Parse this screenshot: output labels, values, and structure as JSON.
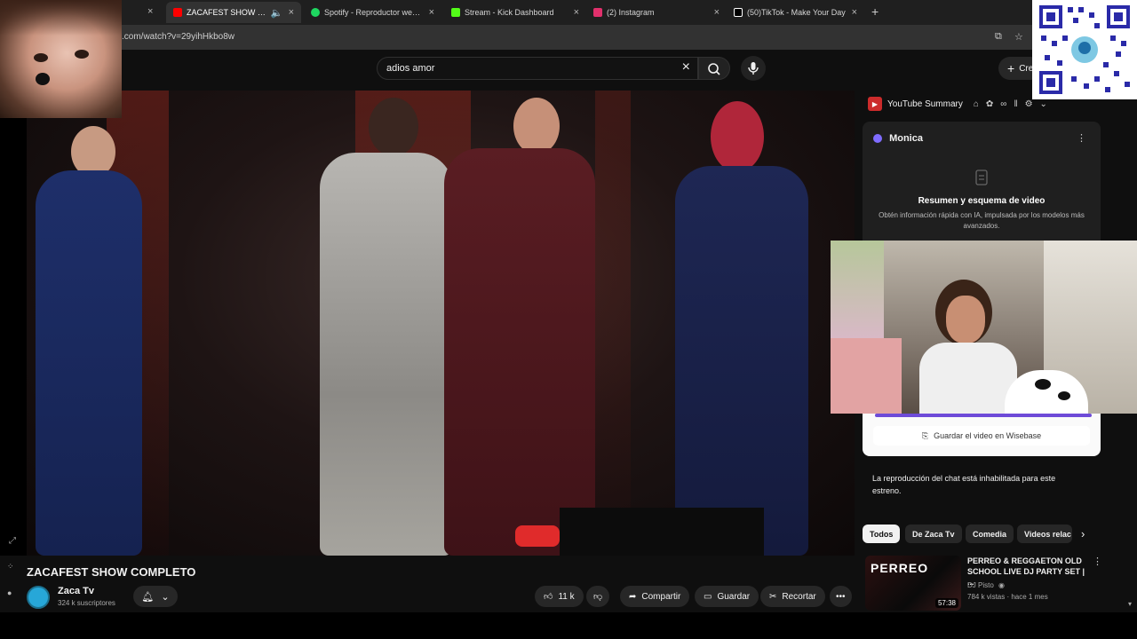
{
  "tabs": [
    {
      "title": "ZACAFEST SHOW COMPLET",
      "color": "#ff0000",
      "active": true
    },
    {
      "title": "Spotify - Reproductor web: mú",
      "color": "#1ed760"
    },
    {
      "title": "Stream - Kick Dashboard",
      "color": "#53fc18"
    },
    {
      "title": "(2) Instagram",
      "color": "#e1306c"
    },
    {
      "title": "(50)TikTok - Make Your Day",
      "color": "#ffffff"
    }
  ],
  "address": {
    "url": ".com/watch?v=29yihHkbo8w"
  },
  "search": {
    "query": "adios amor"
  },
  "header": {
    "create_label": "Cre"
  },
  "video": {
    "title": "ZACAFEST SHOW COMPLETO",
    "channel": "Zaca Tv",
    "subscribers": "324 k suscriptores",
    "likes": "11 k",
    "share_label": "Compartir",
    "save_label": "Guardar",
    "clip_label": "Recortar"
  },
  "extension": {
    "name": "YouTube Summary"
  },
  "monica": {
    "name": "Monica",
    "heading": "Resumen y esquema de video",
    "description": "Obtén información rápida con IA, impulsada por los modelos más avanzados.",
    "wisebase_label": "Guardar el video en Wisebase"
  },
  "chat": {
    "disabled_message": "La reproducción del chat está inhabilitada para este estreno."
  },
  "chips": [
    "Todos",
    "De Zaca Tv",
    "Comedia",
    "Videos relac"
  ],
  "recommendation": {
    "title": "PERREO & REGGAETON OLD SCHOOL LIVE DJ PARTY SET | ...",
    "channel": "DJ Pisto",
    "meta": "784 k vistas · hace 1 mes",
    "duration": "57:38",
    "thumb_text": "PERREO"
  }
}
